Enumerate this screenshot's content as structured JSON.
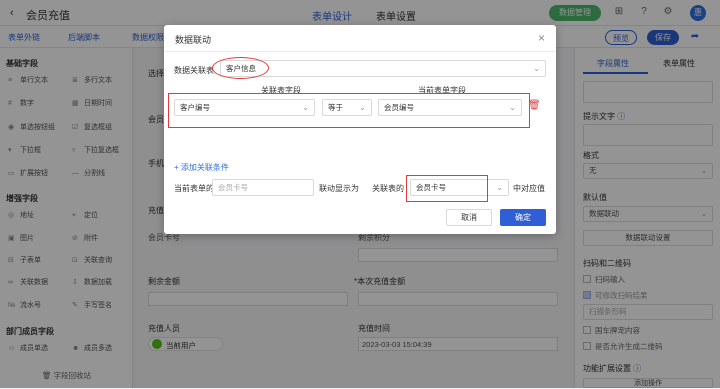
{
  "header": {
    "back_arrow": "‹",
    "app_title": "会员充值",
    "tabs": [
      "表单设计",
      "表单设置"
    ],
    "publish_label": "数据管理",
    "avatar_text": "惠"
  },
  "toolbar": {
    "items": [
      "表单外链",
      "后端脚本",
      "数据权限"
    ],
    "preview_label": "预览",
    "save_label": "保存"
  },
  "sidebar": {
    "group_basic": "基础字段",
    "basic_items": [
      [
        "单行文本",
        "多行文本"
      ],
      [
        "数字",
        "日期时间"
      ],
      [
        "单选按钮组",
        "复选框组"
      ],
      [
        "下拉框",
        "下拉复选框"
      ],
      [
        "扩展按钮",
        "分割线"
      ]
    ],
    "group_enhanced": "增强字段",
    "enhanced_items": [
      [
        "地址",
        "定位"
      ],
      [
        "图片",
        "附件"
      ],
      [
        "子表单",
        "关联查询"
      ],
      [
        "关联数据",
        "数据加载"
      ],
      [
        "流水号",
        "手写签名"
      ]
    ],
    "group_dept": "部门成员字段",
    "dept_items": [
      [
        "成员单选",
        "成员多选"
      ]
    ],
    "footer": "字段回收站"
  },
  "canvas": {
    "select_label": "选择",
    "member_label": "会员",
    "phone_label": "手机",
    "recharge_label": "充值",
    "card_label": "会员卡号",
    "points_label": "剩余积分",
    "balance_label": "剩余金额",
    "amount_label": "*本次充值金额",
    "person_label": "充值人员",
    "person_value": "当前用户",
    "time_label": "充值时间",
    "time_value": "2023-03-03 15:04:39"
  },
  "right_panel": {
    "tabs": [
      "字段属性",
      "表单属性"
    ],
    "hint_label": "提示文字",
    "format_label": "格式",
    "format_value": "无",
    "default_label": "默认值",
    "default_value": "数据联动",
    "link_button": "数据联动设置",
    "scan_label": "扫码和二维码",
    "scan_items": [
      "扫码输入",
      "可修改扫码结果",
      "扫描条形码",
      "国车牌宠内容",
      "是否允许生成二维码"
    ],
    "ext_label": "功能扩展设置",
    "add_btn": "添加操作"
  },
  "modal": {
    "title": "数据联动",
    "close": "×",
    "source_label": "数据关联表",
    "source_value": "客户信息",
    "col_related": "关联表字段",
    "col_current": "当前表单字段",
    "cond_field": "客户编号",
    "cond_op": "等于",
    "cond_target": "会员编号",
    "add_condition": "+ 添加关联条件",
    "bottom_label1": "当前表单的",
    "bottom_placeholder": "会员卡号",
    "bottom_label2": "联动显示为",
    "bottom_label3": "关联表的",
    "bottom_value": "会员卡号",
    "bottom_label4": "中对应值",
    "cancel": "取消",
    "ok": "确定"
  }
}
